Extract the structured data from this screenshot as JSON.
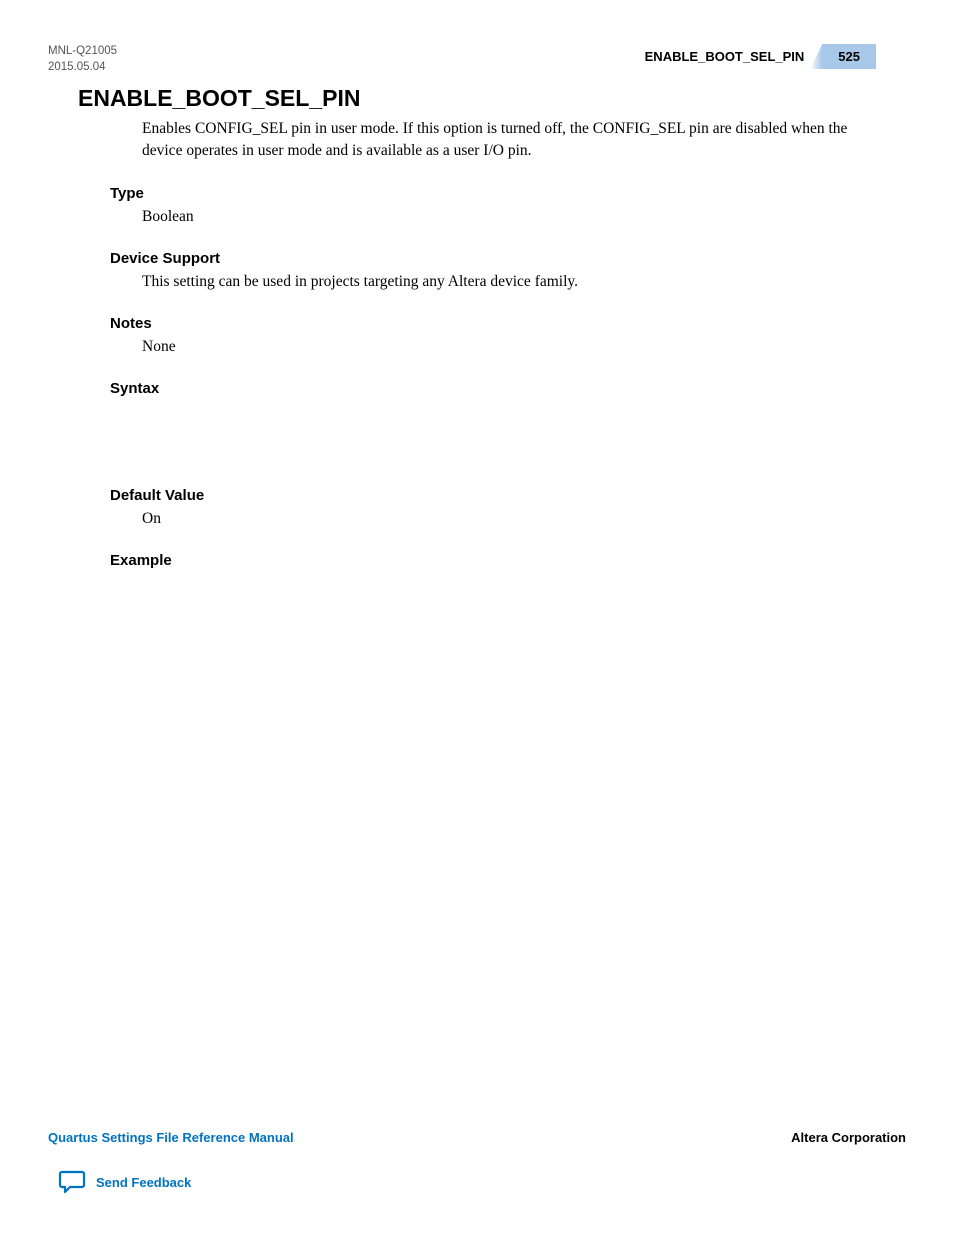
{
  "header": {
    "doc_id": "MNL-Q21005",
    "date": "2015.05.04",
    "topic": "ENABLE_BOOT_SEL_PIN",
    "page_number": "525"
  },
  "main": {
    "title": "ENABLE_BOOT_SEL_PIN",
    "intro": "Enables CONFIG_SEL pin in user mode. If this option is turned off, the CONFIG_SEL pin are disabled when the device operates in user mode and is available as a user I/O pin.",
    "sections": {
      "type": {
        "heading": "Type",
        "body": "Boolean"
      },
      "device_support": {
        "heading": "Device Support",
        "body": "This setting can be used in projects targeting any Altera device family."
      },
      "notes": {
        "heading": "Notes",
        "body": "None"
      },
      "syntax": {
        "heading": "Syntax",
        "body": ""
      },
      "default_value": {
        "heading": "Default Value",
        "body": "On"
      },
      "example": {
        "heading": "Example",
        "body": ""
      }
    }
  },
  "footer": {
    "manual_title": "Quartus Settings File Reference Manual",
    "company": "Altera Corporation",
    "feedback_label": "Send Feedback"
  }
}
